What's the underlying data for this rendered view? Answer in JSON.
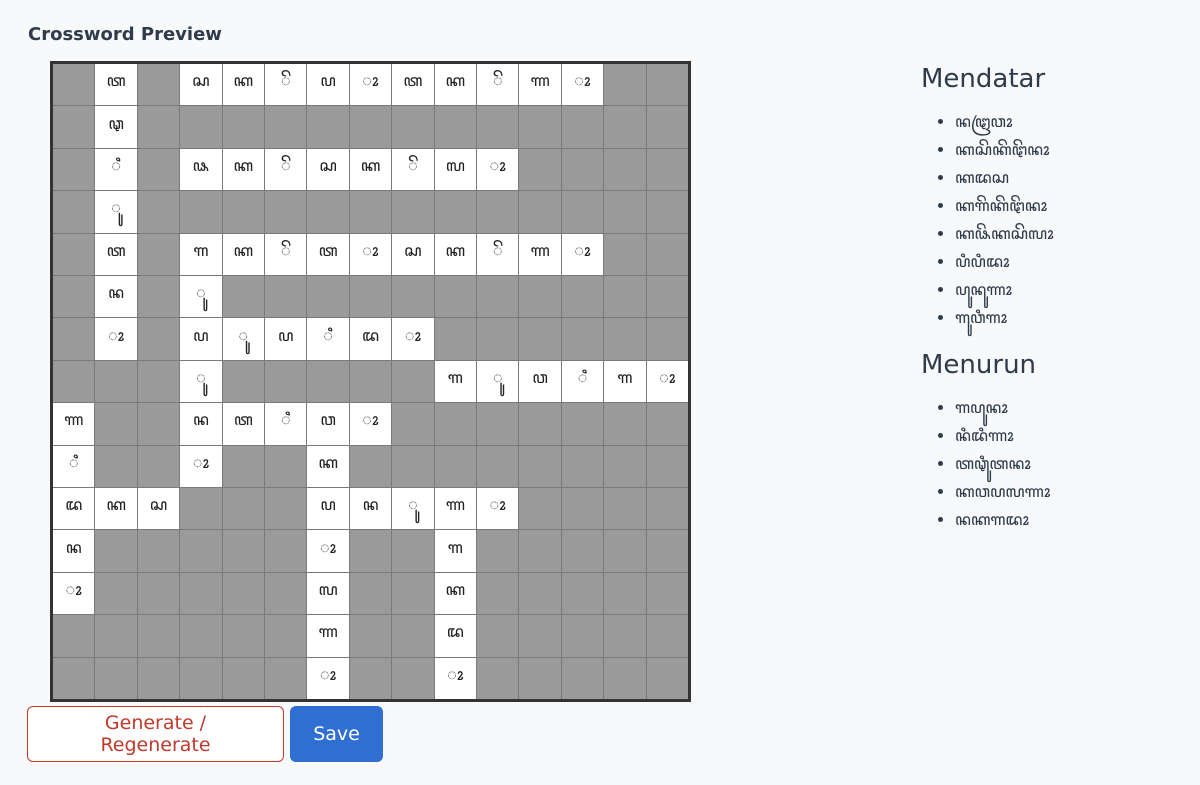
{
  "header": {
    "title": "Crossword Preview"
  },
  "grid": {
    "rows": [
      [
        "",
        "ꦠ",
        "",
        "ꦱ",
        "ꦏ",
        "ꦼ",
        "ꦥ",
        "ꦴ",
        "ꦠ",
        "ꦏ",
        "ꦼ",
        "ꦟ",
        "ꦴ",
        "",
        ""
      ],
      [
        "",
        "ꦡ",
        "",
        "",
        "",
        "",
        "",
        "",
        "",
        "",
        "",
        "",
        "",
        "",
        ""
      ],
      [
        "",
        "ꦶ",
        "",
        "ꦦ",
        "ꦏ",
        "ꦼ",
        "ꦱ",
        "ꦏ",
        "ꦼ",
        "ꦭ",
        "ꦴ",
        "",
        "",
        "",
        ""
      ],
      [
        "",
        "ꦸ",
        "",
        "",
        "",
        "",
        "",
        "",
        "",
        "",
        "",
        "",
        "",
        "",
        ""
      ],
      [
        "",
        "ꦠ",
        "",
        "ꦒ",
        "ꦏ",
        "ꦼ",
        "ꦠ",
        "ꦴ",
        "ꦱ",
        "ꦏ",
        "ꦼ",
        "ꦟ",
        "ꦴ",
        "",
        ""
      ],
      [
        "",
        "ꦤ",
        "",
        "ꦸ",
        "",
        "",
        "",
        "",
        "",
        "",
        "",
        "",
        "",
        "",
        ""
      ],
      [
        "",
        "ꦴ",
        "",
        "ꦥ",
        "ꦸ",
        "ꦥ",
        "ꦶ",
        "ꦢ",
        "ꦴ",
        "",
        "",
        "",
        "",
        "",
        ""
      ],
      [
        "",
        "",
        "",
        "ꦸ",
        "",
        "",
        "",
        "",
        "",
        "ꦒ",
        "ꦸ",
        "ꦮ",
        "ꦶ",
        "ꦒ",
        "ꦴ"
      ],
      [
        "ꦟ",
        "",
        "",
        "ꦤ",
        "ꦠ",
        "ꦶ",
        "ꦮ",
        "ꦴ",
        "",
        "",
        "",
        "",
        "",
        "",
        ""
      ],
      [
        "ꦶ",
        "",
        "",
        "ꦴ",
        "",
        "",
        "ꦏ",
        "",
        "",
        "",
        "",
        "",
        "",
        "",
        ""
      ],
      [
        "ꦢ",
        "ꦏ",
        "ꦱ",
        "",
        "",
        "",
        "ꦥ",
        "ꦤ",
        "ꦸ",
        "ꦟ",
        "ꦴ",
        "",
        "",
        "",
        ""
      ],
      [
        "ꦤ",
        "",
        "",
        "",
        "",
        "",
        "ꦴ",
        "",
        "",
        "ꦒ",
        "",
        "",
        "",
        "",
        ""
      ],
      [
        "ꦴ",
        "",
        "",
        "",
        "",
        "",
        "ꦭ",
        "",
        "",
        "ꦏ",
        "",
        "",
        "",
        "",
        ""
      ],
      [
        "",
        "",
        "",
        "",
        "",
        "",
        "ꦟ",
        "",
        "",
        "ꦢ",
        "",
        "",
        "",
        "",
        ""
      ],
      [
        "",
        "",
        "",
        "",
        "",
        "",
        "ꦴ",
        "",
        "",
        "ꦴ",
        "",
        "",
        "",
        "",
        ""
      ]
    ],
    "white": [
      [
        1,
        3,
        4,
        5,
        6,
        7,
        8,
        9,
        10,
        11,
        12
      ],
      [
        1
      ],
      [
        1,
        3,
        4,
        5,
        6,
        7,
        8,
        9,
        10
      ],
      [
        1
      ],
      [
        1,
        3,
        4,
        5,
        6,
        7,
        8,
        9,
        10,
        11,
        12
      ],
      [
        1,
        3
      ],
      [
        1,
        3,
        4,
        5,
        6,
        7,
        8
      ],
      [
        3,
        9,
        10,
        11,
        12,
        13,
        14
      ],
      [
        0,
        3,
        4,
        5,
        6,
        7
      ],
      [
        0,
        3,
        6
      ],
      [
        0,
        1,
        2,
        6,
        7,
        8,
        9,
        10
      ],
      [
        0,
        6,
        9
      ],
      [
        0,
        6,
        9
      ],
      [
        6,
        9
      ],
      [
        6,
        9
      ]
    ]
  },
  "actions": {
    "generate_label": "Generate / Regenerate",
    "save_label": "Save"
  },
  "clues": {
    "across_title": "Mendatar",
    "across": [
      "ꦤꦛꦿꦮꦴ",
      "ꦏꦱꦼꦏꦼꦛꦼꦤꦴ",
      "ꦏꦢꦱ",
      "ꦏꦒꦼꦏꦼꦛꦼꦤꦴ",
      "ꦏꦦꦼꦏꦱꦼꦭꦴ",
      "ꦥꦶꦥꦶꦢꦴ",
      "ꦥꦸꦤꦸꦟꦴ",
      "ꦒꦸꦮꦶꦒꦴ"
    ],
    "down_title": "Menurun",
    "down": [
      "ꦒꦥꦸꦤꦴ",
      "ꦤꦶꦢꦶꦟꦴ",
      "ꦠꦡꦶꦸꦠꦤꦴ",
      "ꦏꦮꦥꦭꦟꦴ",
      "ꦤꦏꦒꦢꦴ"
    ]
  }
}
